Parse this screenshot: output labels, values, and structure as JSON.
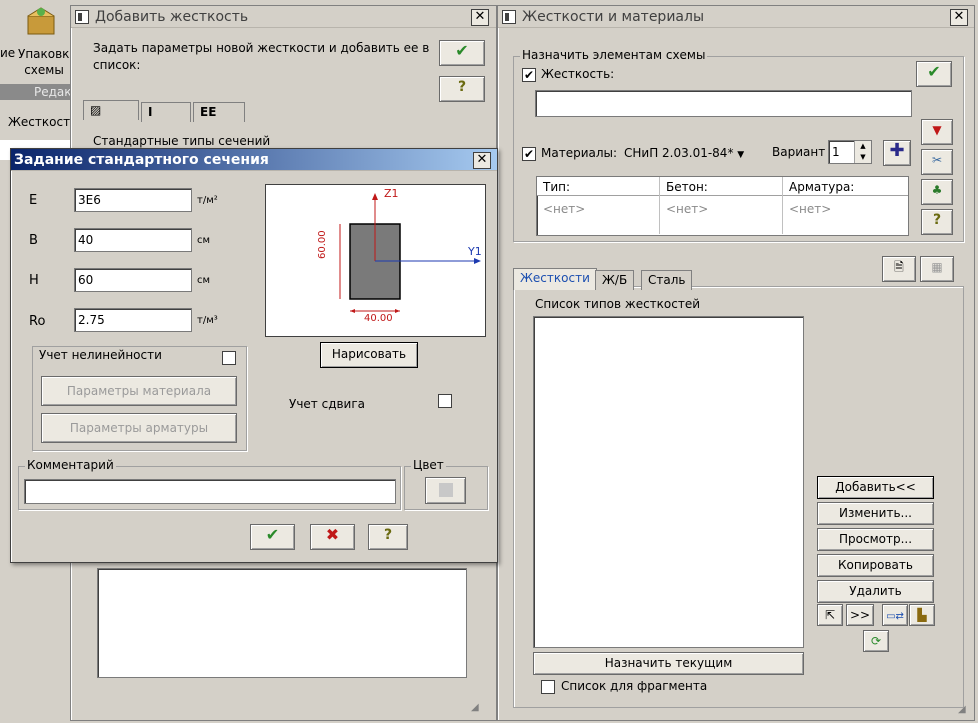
{
  "bg": {
    "toolbar_left_label1": "ие",
    "toolbar_packing_label": "Упаковка схемы",
    "ribbon_edit": "Редак",
    "stiff_tab_left": "Жесткости"
  },
  "add_dialog": {
    "title": "Добавить жесткость",
    "desc": "Задать параметры новой жесткости и добавить ее в список:",
    "tabs": [
      "",
      "I",
      "EE"
    ],
    "std_types": "Стандартные типы сечений"
  },
  "std_section": {
    "title": "Задание стандартного сечения",
    "params": [
      {
        "name": "E",
        "value": "3E6",
        "unit": "т/м²"
      },
      {
        "name": "B",
        "value": "40",
        "unit": "см"
      },
      {
        "name": "H",
        "value": "60",
        "unit": "см"
      },
      {
        "name": "Ro",
        "value": "2.75",
        "unit": "т/м³"
      }
    ],
    "nonlinear_label": "Учет нелинейности",
    "material_params_btn": "Параметры материала",
    "rebar_params_btn": "Параметры арматуры",
    "draw_btn": "Нарисовать",
    "shear_label": "Учет сдвига",
    "comment_label": "Комментарий",
    "color_label": "Цвет",
    "preview": {
      "z_axis": "Z1",
      "y_axis": "Y1",
      "height_dim": "60.00",
      "width_dim": "40.00"
    }
  },
  "stiff_mat": {
    "title": "Жесткости и материалы",
    "assign_group": "Назначить элементам схемы",
    "stiffness_label": "Жесткость:",
    "materials_label": "Материалы:",
    "norm": "СНиП 2.03.01-84*",
    "variant_label": "Вариант",
    "variant_value": "1",
    "table_headers": [
      "Тип:",
      "Бетон:",
      "Арматура:"
    ],
    "table_row": [
      "<нет>",
      "<нет>",
      "<нет>"
    ],
    "tabs": [
      "Жесткости",
      "Ж/Б",
      "Сталь"
    ],
    "list_label": "Список типов жесткостей",
    "buttons": {
      "add": "Добавить<<",
      "edit": "Изменить...",
      "view": "Просмотр...",
      "copy": "Копировать",
      "delete": "Удалить",
      "set_current": "Назначить текущим"
    },
    "nav_next": ">>",
    "fragment_label": "Список для фрагмента"
  }
}
